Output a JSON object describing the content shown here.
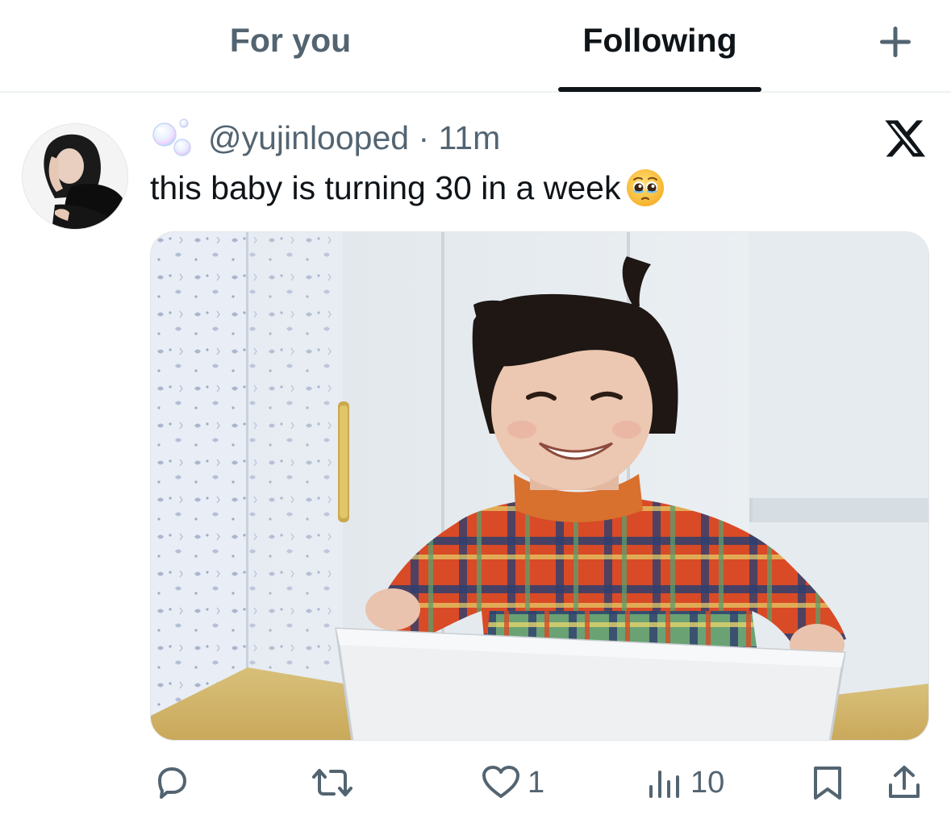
{
  "tabs": {
    "for_you": "For you",
    "following": "Following",
    "add_icon": "plus-icon"
  },
  "tweet": {
    "handle": "@yujinlooped",
    "separator": "·",
    "time": "11m",
    "text": "this baby is turning 30 in a week",
    "emoji": "pleading-face",
    "badge_icon": "bubbles-icon",
    "source_icon": "x-logo-icon",
    "media": {
      "kind": "photo"
    }
  },
  "actions": {
    "reply_icon": "reply-icon",
    "repost_icon": "repost-icon",
    "like_icon": "heart-icon",
    "like_count": "1",
    "views_icon": "views-icon",
    "views_count": "10",
    "bookmark_icon": "bookmark-icon",
    "share_icon": "share-icon"
  },
  "colors": {
    "text_primary": "#0f1419",
    "text_secondary": "#536471",
    "divider": "#eff3f4"
  }
}
